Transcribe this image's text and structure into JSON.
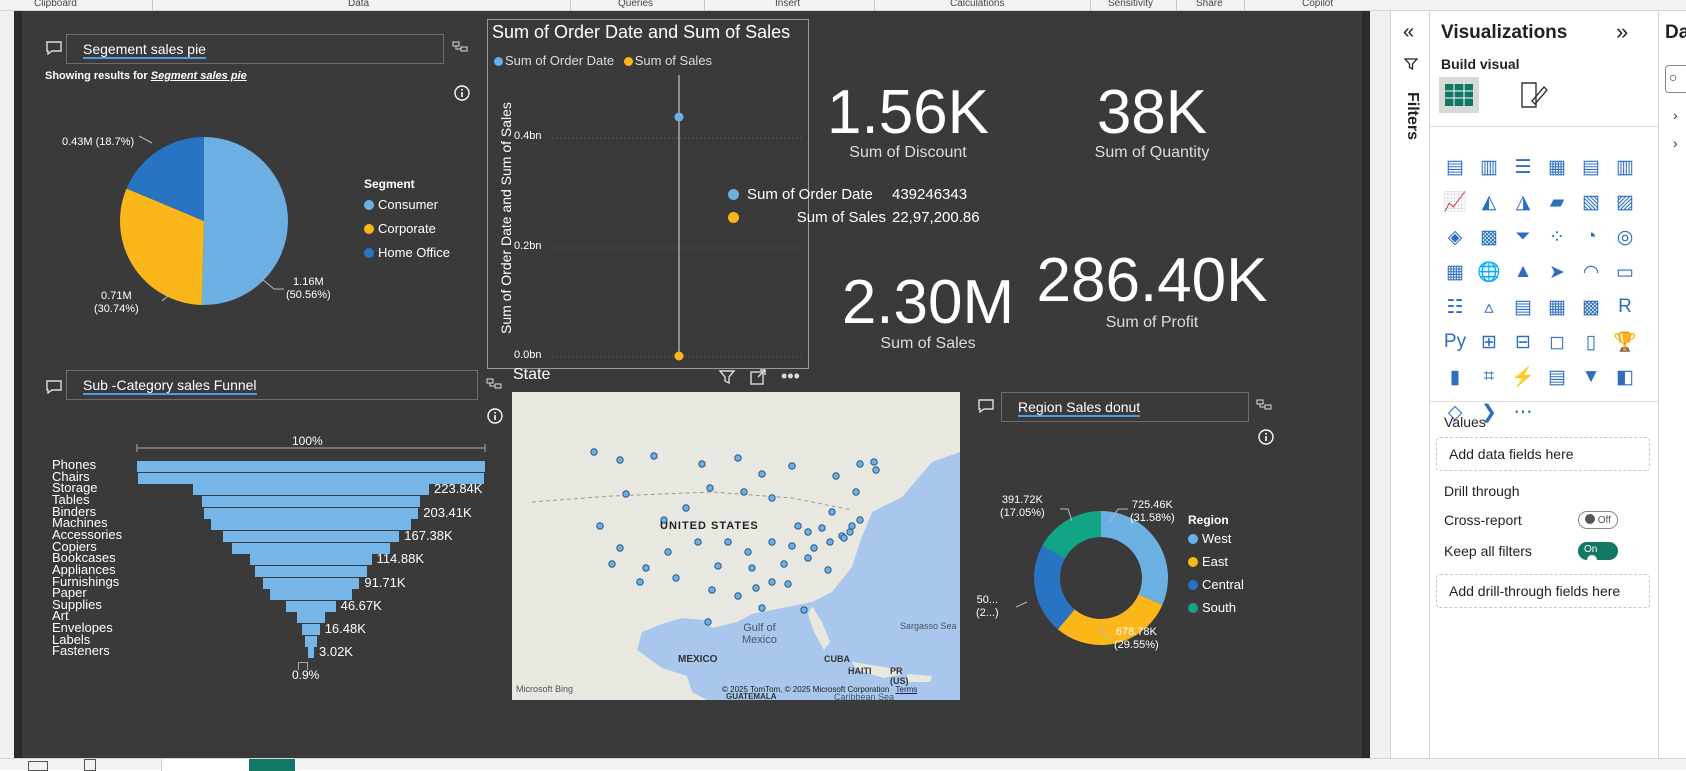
{
  "ribbon": [
    "Clipboard",
    "Data",
    "Queries",
    "Insert",
    "Calculations",
    "Sensitivity",
    "Share",
    "Copilot"
  ],
  "pie": {
    "title": "Segement sales pie",
    "showing_prefix": "Showing results for",
    "showing_name": "Segment sales pie",
    "legend_title": "Segment",
    "legend": [
      "Consumer",
      "Corporate",
      "Home Office"
    ],
    "labels": {
      "consumer_val": "1.16M",
      "consumer_pct": "(50.56%)",
      "corporate_val": "0.71M",
      "corporate_pct": "(30.74%)",
      "home": "0.43M (18.7%)"
    }
  },
  "scatter": {
    "title": "Sum of Order Date and Sum of Sales",
    "legend": [
      "Sum of Order Date",
      "Sum of Sales"
    ],
    "ylabel": "Sum of Order Date and Sum of Sales",
    "ticks": [
      "0.4bn",
      "0.2bn",
      "0.0bn"
    ]
  },
  "tooltip": {
    "l1": "Sum of Order Date",
    "v1": "439246343",
    "l2": "Sum of Sales",
    "v2": "22,97,200.86"
  },
  "kpis": [
    {
      "value": "1.56K",
      "label": "Sum of Discount"
    },
    {
      "value": "38K",
      "label": "Sum of Quantity"
    },
    {
      "value": "2.30M",
      "label": "Sum of Sales"
    },
    {
      "value": "286.40K",
      "label": "Sum of Profit"
    }
  ],
  "funnel": {
    "title": "Sub -Category sales Funnel",
    "top_pct": "100%",
    "bottom_pct": "0.9%",
    "categories": [
      "Phones",
      "Chairs",
      "Storage",
      "Tables",
      "Binders",
      "Machines",
      "Accessories",
      "Copiers",
      "Bookcases",
      "Appliances",
      "Furnishings",
      "Paper",
      "Supplies",
      "Art",
      "Envelopes",
      "Labels",
      "Fasteners"
    ],
    "values": [
      "",
      "",
      "223.84K",
      "",
      "203.41K",
      "",
      "167.38K",
      "",
      "114.88K",
      "",
      "91.71K",
      "",
      "46.67K",
      "",
      "16.48K",
      "",
      "3.02K"
    ]
  },
  "map": {
    "title": "State",
    "labels": {
      "us": "UNITED STATES",
      "mexico": "MEXICO",
      "gulf1": "Gulf of",
      "gulf2": "Mexico",
      "cuba": "CUBA",
      "haiti": "HAITI",
      "pr": "PR",
      "prus": "(US)",
      "sargasso": "Sargasso Sea",
      "carib": "Caribbean Sea",
      "guat": "GUATEMALA"
    },
    "bing": "Microsoft Bing",
    "copyright": "© 2025 TomTom, © 2025 Microsoft Corporation",
    "terms": "Terms"
  },
  "donut": {
    "title": "Region Sales donut",
    "legend_title": "Region",
    "legend": [
      "West",
      "East",
      "Central",
      "South"
    ],
    "labels": {
      "west_v": "725.46K",
      "west_p": "(31.58%)",
      "east_v": "678.78K",
      "east_p": "(29.55%)",
      "south_v": "391.72K",
      "south_p": "(17.05%)",
      "central_v": "50...",
      "central_p": "(2...)"
    }
  },
  "filters_label": "Filters",
  "viz_pane": {
    "title": "Visualizations",
    "build_visual": "Build visual",
    "values_label": "Values",
    "values_well": "Add data fields here",
    "drill_through": "Drill through",
    "cross_report": "Cross-report",
    "cross_state": "Off",
    "keep_filters": "Keep all filters",
    "keep_state": "On",
    "drill_well": "Add drill-through fields here",
    "more": "···"
  },
  "data_pane_label": "Da",
  "colors": {
    "light_blue": "#6cb0e3",
    "yellow": "#fbb619",
    "dark_blue": "#2874c2",
    "teal": "#12a585",
    "green_toggle": "#117865"
  },
  "chart_data": [
    {
      "type": "pie",
      "title": "Segement sales pie",
      "categories": [
        "Consumer",
        "Corporate",
        "Home Office"
      ],
      "values": [
        1.16,
        0.71,
        0.43
      ],
      "percent": [
        50.56,
        30.74,
        18.7
      ],
      "unit": "M"
    },
    {
      "type": "scatter",
      "title": "Sum of Order Date and Sum of Sales",
      "ylabel": "Sum of Order Date and Sum of Sales",
      "series": [
        {
          "name": "Sum of Order Date",
          "values": [
            439246343
          ]
        },
        {
          "name": "Sum of Sales",
          "values": [
            2297200.86
          ]
        }
      ],
      "ylim": [
        0,
        0.45
      ]
    },
    {
      "type": "bar",
      "title": "Sub -Category sales Funnel",
      "categories": [
        "Phones",
        "Chairs",
        "Storage",
        "Tables",
        "Binders",
        "Machines",
        "Accessories",
        "Copiers",
        "Bookcases",
        "Appliances",
        "Furnishings",
        "Paper",
        "Supplies",
        "Art",
        "Envelopes",
        "Labels",
        "Fasteners"
      ],
      "values": [
        330,
        328,
        223.84,
        207,
        203.41,
        189,
        167.38,
        150,
        114.88,
        107,
        91.71,
        78,
        46.67,
        27,
        16.48,
        12,
        3.02
      ],
      "unit": "K"
    },
    {
      "type": "pie",
      "title": "Region Sales donut",
      "categories": [
        "West",
        "East",
        "Central",
        "South"
      ],
      "values": [
        725.46,
        678.78,
        501.24,
        391.72
      ],
      "percent": [
        31.58,
        29.55,
        21.82,
        17.05
      ],
      "unit": "K"
    }
  ]
}
